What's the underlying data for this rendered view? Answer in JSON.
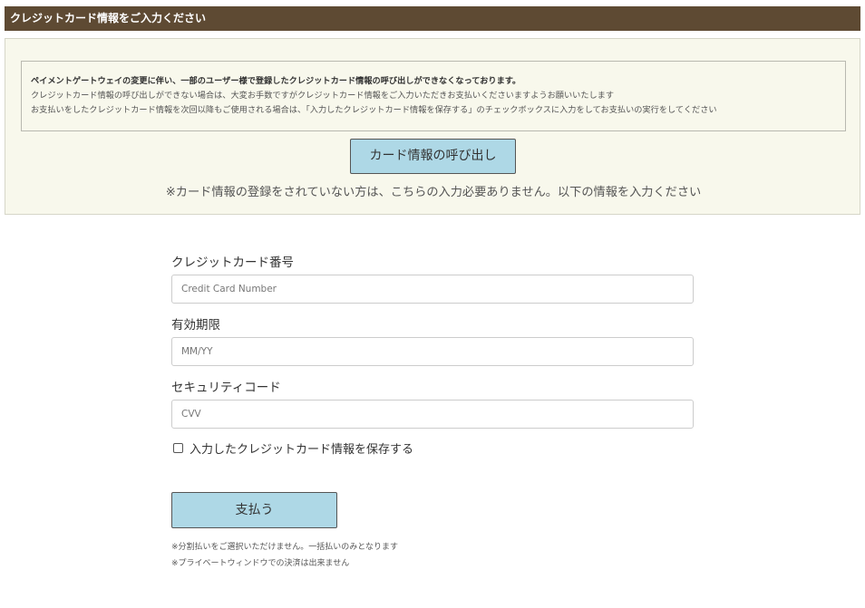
{
  "header": {
    "title": "クレジットカード情報をご入力ください"
  },
  "notice": {
    "line1": "ペイメントゲートウェイの変更に伴い、一部のユーザー様で登録したクレジットカード情報の呼び出しができなくなっております。",
    "line2": "クレジットカード情報の呼び出しができない場合は、大変お手数ですがクレジットカード情報をご入力いただきお支払いくださいますようお願いいたします",
    "line3": "お支払いをしたクレジットカード情報を次回以降もご使用される場合は、「入力したクレジットカード情報を保存する」のチェックボックスに入力をしてお支払いの実行をしてください",
    "recall_button_label": "カード情報の呼び出し",
    "no_input_note": "※カード情報の登録をされていない方は、こちらの入力必要ありません。以下の情報を入力ください"
  },
  "form": {
    "card_number_label": "クレジットカード番号",
    "card_number_placeholder": "Credit Card Number",
    "card_number_value": "",
    "expiry_label": "有効期限",
    "expiry_placeholder": "MM/YY",
    "expiry_value": "",
    "cvv_label": "セキュリティコード",
    "cvv_placeholder": "CVV",
    "cvv_value": "",
    "save_checkbox_label": "入力したクレジットカード情報を保存する",
    "save_checked": false,
    "pay_button_label": "支払う",
    "footnote1": "※分割払いをご選択いただけません。一括払いのみとなります",
    "footnote2": "※プライベートウィンドウでの決済は出来ません"
  },
  "colors": {
    "header_bg": "#5e4a33",
    "panel_bg": "#f8f8ec",
    "button_bg": "#aed8e6"
  }
}
